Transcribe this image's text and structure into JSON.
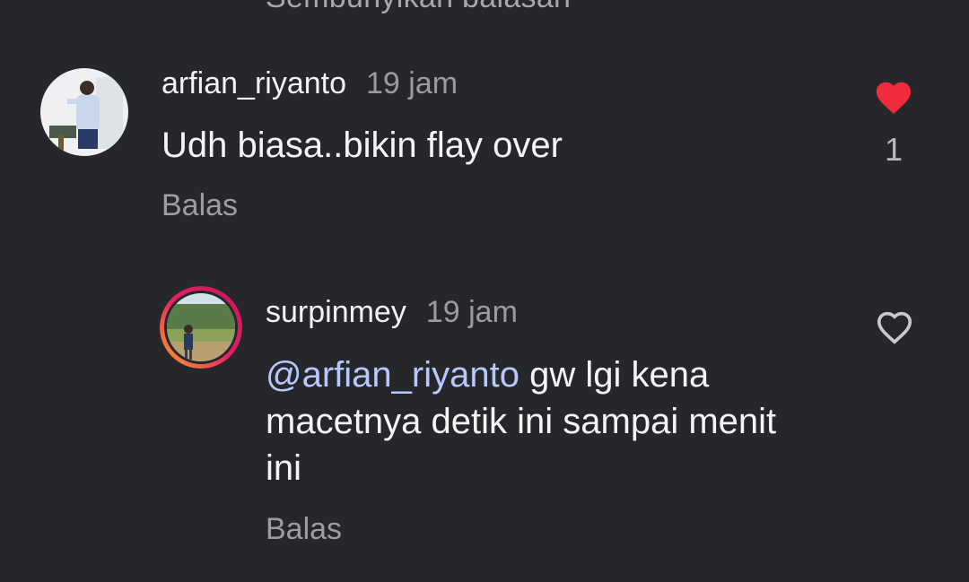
{
  "top_partial_text": "Sembunyikan balasan",
  "comments": [
    {
      "username": "arfian_riyanto",
      "time": "19 jam",
      "text": "Udh biasa..bikin flay over",
      "reply_label": "Balas",
      "liked": true,
      "like_count": "1",
      "like_color": "#f22b3c"
    },
    {
      "username": "surpinmey",
      "time": "19 jam",
      "mention": "@arfian_riyanto",
      "text": " gw lgi kena macetnya detik ini sampai menit ini",
      "reply_label": "Balas",
      "liked": false,
      "story_ring": true
    }
  ],
  "colors": {
    "background": "#26272b",
    "mention": "#b8c8ff",
    "secondary_text": "#9c9da2"
  },
  "icons": {
    "like_filled": "heart-filled-icon",
    "like_outline": "heart-outline-icon"
  }
}
